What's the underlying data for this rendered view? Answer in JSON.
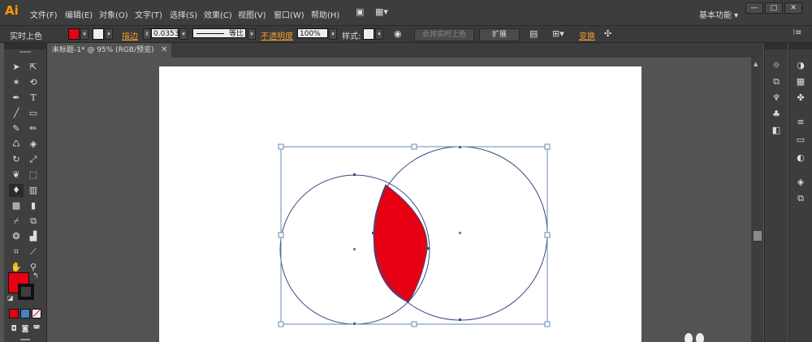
{
  "app": {
    "logo": "Ai"
  },
  "menu": [
    "文件(F)",
    "编辑(E)",
    "对象(O)",
    "文字(T)",
    "选择(S)",
    "效果(C)",
    "视图(V)",
    "窗口(W)",
    "帮助(H)"
  ],
  "workspace": "基本功能",
  "window_buttons": {
    "minimize": "—",
    "maximize": "□",
    "close": "✕"
  },
  "control": {
    "selection_label": "实时上色",
    "fill_color": "#e60012",
    "stroke_link": "描边",
    "stroke_weight": "0.0353",
    "stroke_profile": "等比",
    "opacity_label": "不透明度",
    "opacity_value": "100%",
    "style_label": "样式:",
    "merge_button": "合并实时上色",
    "expand_button": "扩展",
    "transform_link": "变换"
  },
  "document": {
    "tab_title": "未标题-1* @ 95% (RGB/预览)",
    "tab_close": "✕"
  },
  "colors": {
    "fill": "#e60012",
    "stroke": "#111111",
    "artboard": "#ffffff",
    "canvas": "#535353",
    "path": "#3a4a80",
    "selection": "#6a88b0",
    "orange": "#f0a030"
  },
  "tools": [
    "selection-tool",
    "direct-selection-tool",
    "magic-wand-tool",
    "lasso-tool",
    "pen-tool",
    "type-tool",
    "line-tool",
    "rectangle-tool",
    "paintbrush-tool",
    "pencil-tool",
    "blob-brush-tool",
    "eraser-tool",
    "rotate-tool",
    "scale-tool",
    "warp-tool",
    "free-transform-tool",
    "live-paint-bucket-tool",
    "graph-tool",
    "mesh-tool",
    "gradient-tool",
    "eyedropper-tool",
    "blend-tool",
    "symbol-sprayer-tool",
    "column-graph-tool",
    "artboard-tool",
    "slice-tool",
    "hand-tool",
    "zoom-tool"
  ]
}
